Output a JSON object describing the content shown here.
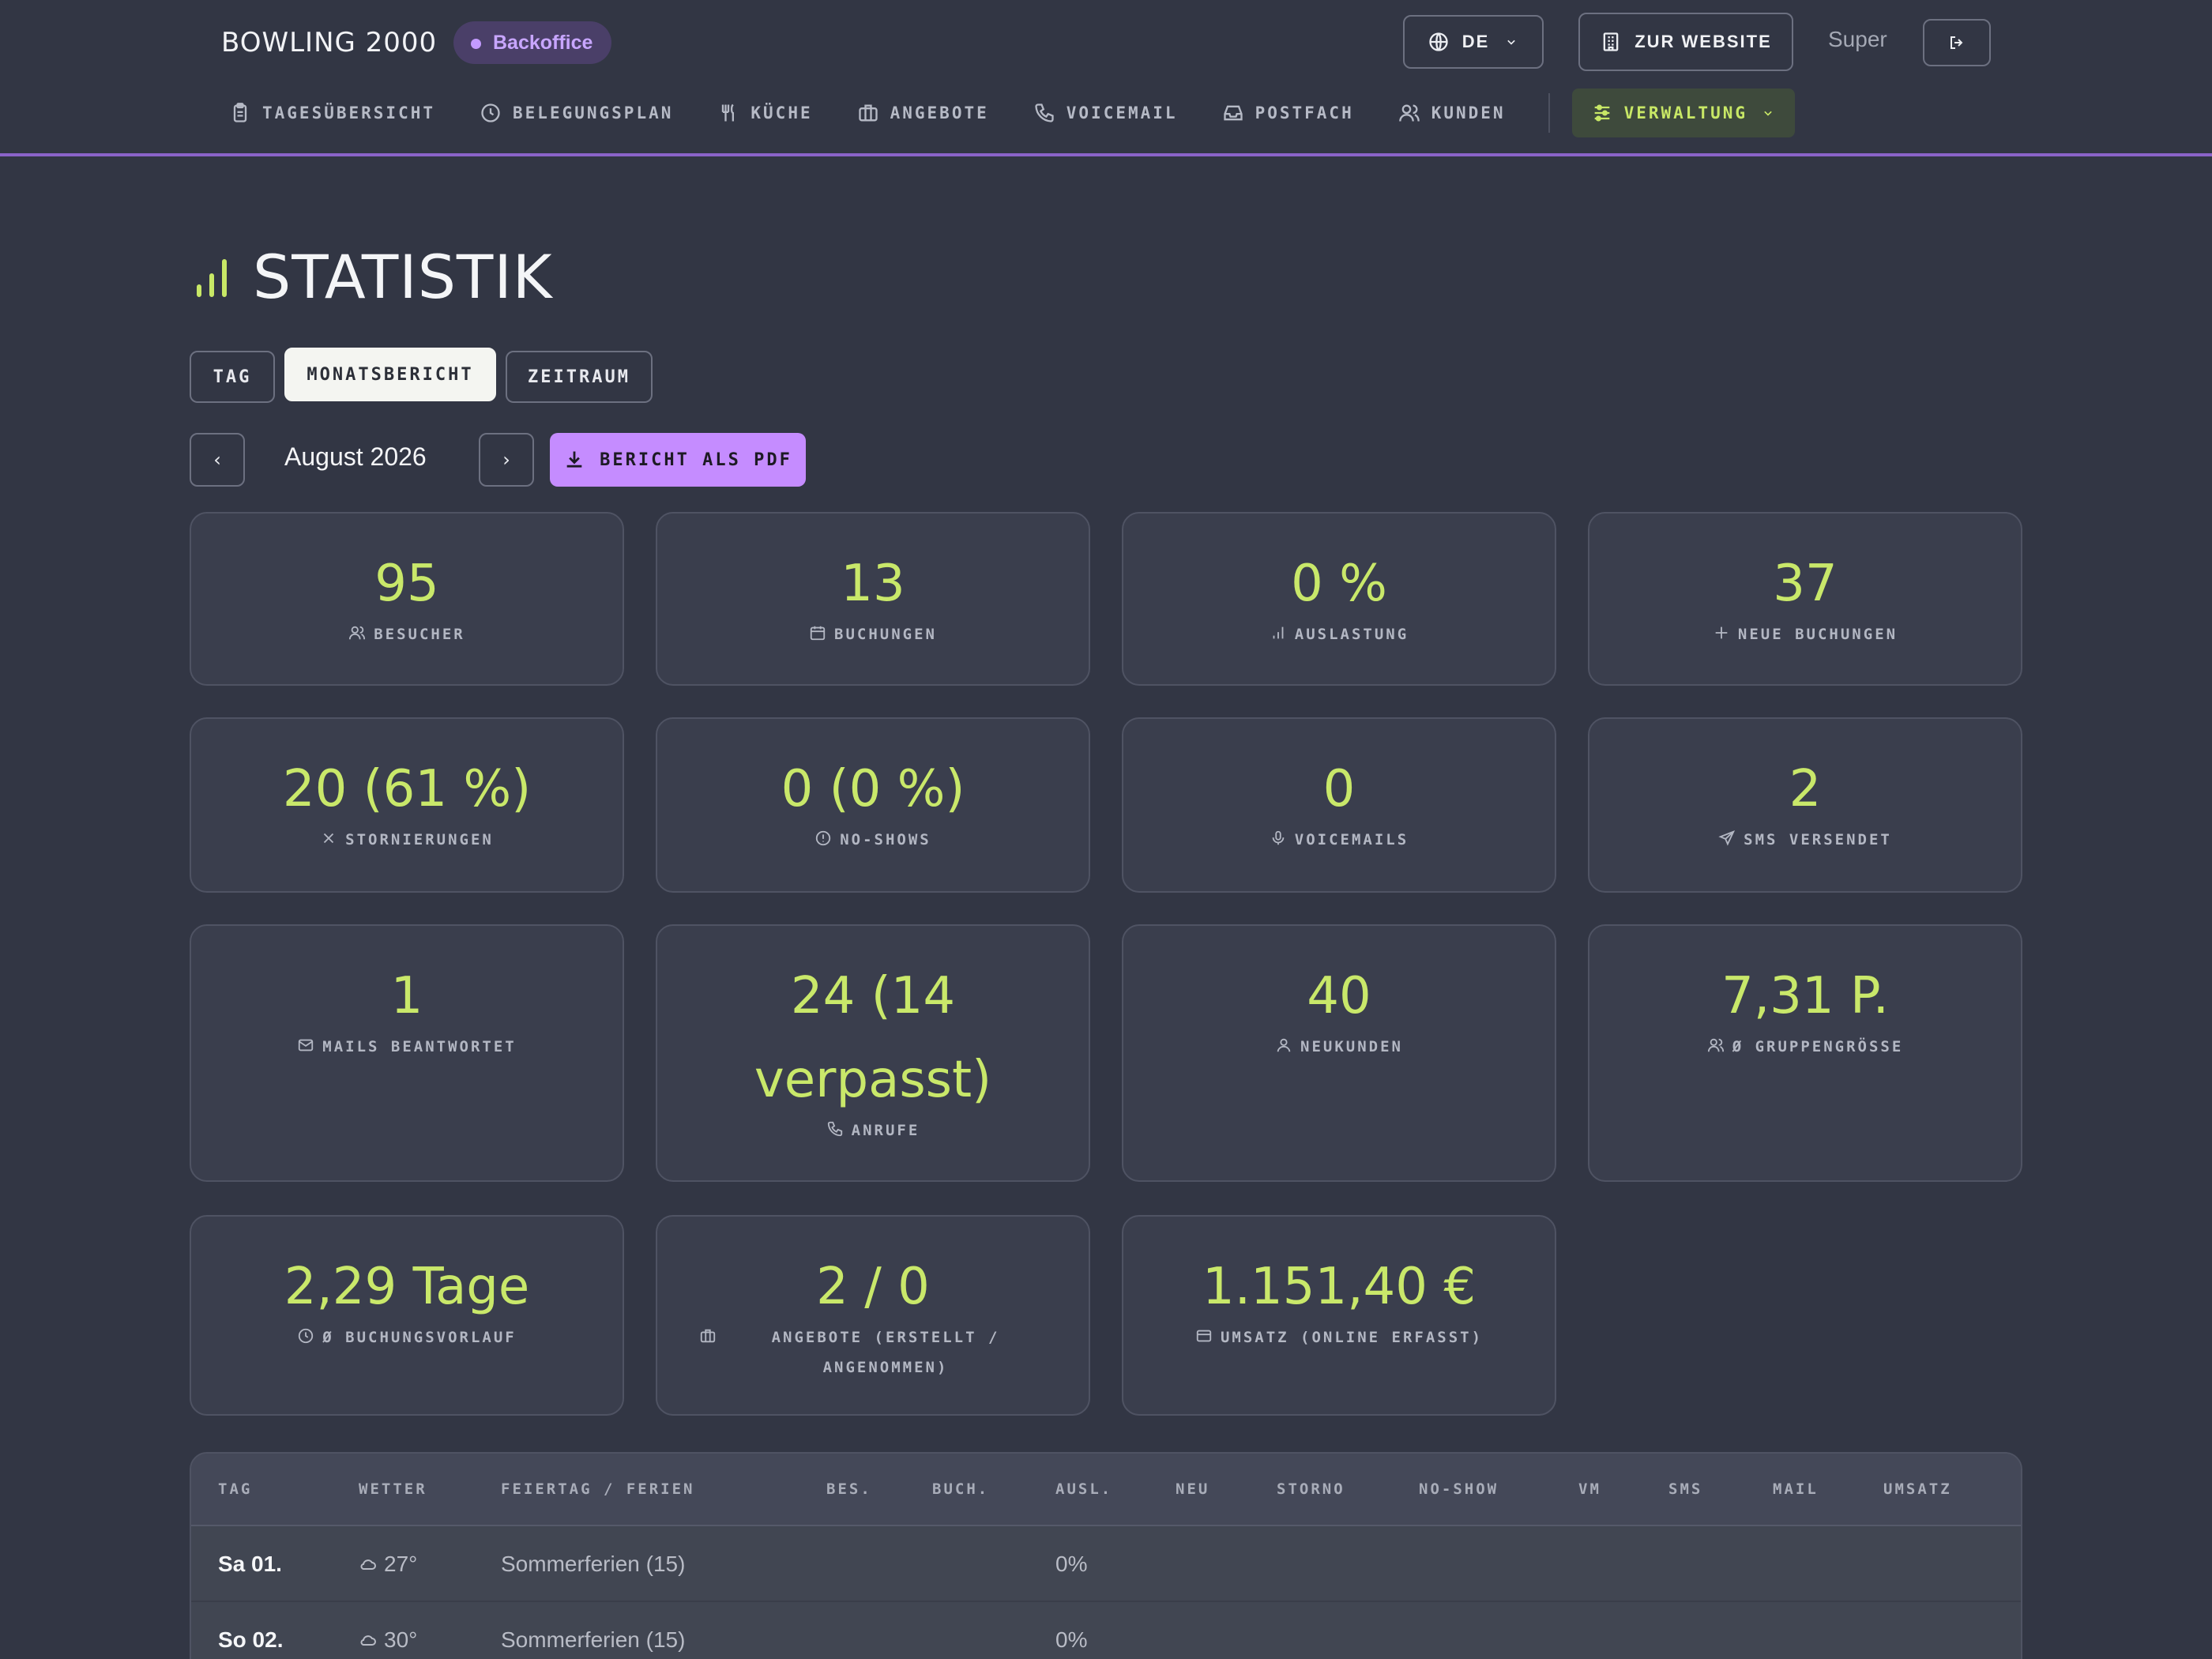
{
  "header": {
    "brand": "BOWLING 2000",
    "badge": "Backoffice",
    "language": "DE",
    "website_button": "ZUR WEBSITE",
    "user": "Super"
  },
  "nav": {
    "items": [
      {
        "label": "TAGESÜBERSICHT",
        "icon": "clipboard-icon"
      },
      {
        "label": "BELEGUNGSPLAN",
        "icon": "clock-icon"
      },
      {
        "label": "KÜCHE",
        "icon": "utensils-icon"
      },
      {
        "label": "ANGEBOTE",
        "icon": "briefcase-icon"
      },
      {
        "label": "VOICEMAIL",
        "icon": "phone-icon"
      },
      {
        "label": "POSTFACH",
        "icon": "inbox-icon"
      },
      {
        "label": "KUNDEN",
        "icon": "users-icon"
      }
    ],
    "admin": "VERWALTUNG"
  },
  "page": {
    "title": "STATISTIK",
    "tabs": [
      "TAG",
      "MONATSBERICHT",
      "ZEITRAUM"
    ],
    "active_tab": "MONATSBERICHT",
    "month": "August 2026",
    "prev": "‹",
    "next": "›",
    "pdf_button": "BERICHT ALS PDF"
  },
  "stats": [
    {
      "value": "95",
      "label": "BESUCHER",
      "icon": "users-icon"
    },
    {
      "value": "13",
      "label": "BUCHUNGEN",
      "icon": "calendar-icon"
    },
    {
      "value": "0 %",
      "label": "AUSLASTUNG",
      "icon": "bar-chart-icon"
    },
    {
      "value": "37",
      "label": "NEUE BUCHUNGEN",
      "icon": "plus-icon"
    },
    {
      "value": "20 (61 %)",
      "label": "STORNIERUNGEN",
      "icon": "x-icon"
    },
    {
      "value": "0 (0 %)",
      "label": "NO-SHOWS",
      "icon": "alert-icon"
    },
    {
      "value": "0",
      "label": "VOICEMAILS",
      "icon": "mic-icon"
    },
    {
      "value": "2",
      "label": "SMS VERSENDET",
      "icon": "send-icon"
    },
    {
      "value": "1",
      "label": "MAILS BEANTWORTET",
      "icon": "mail-icon"
    },
    {
      "value": "24 (14 verpasst)",
      "label": "ANRUFE",
      "icon": "phone-icon"
    },
    {
      "value": "40",
      "label": "NEUKUNDEN",
      "icon": "user-icon"
    },
    {
      "value": "7,31 P.",
      "label": "Ø GRUPPENGRÖSSE",
      "icon": "users-icon"
    },
    {
      "value": "2,29 Tage",
      "label": "Ø BUCHUNGSVORLAUF",
      "icon": "clock-icon"
    },
    {
      "value": "2 / 0",
      "label": "ANGEBOTE (ERSTELLT / ANGENOMMEN)",
      "icon": "briefcase-icon"
    },
    {
      "value": "1.151,40 €",
      "label": "UMSATZ (ONLINE ERFASST)",
      "icon": "credit-card-icon"
    }
  ],
  "table": {
    "columns": [
      "TAG",
      "WETTER",
      "FEIERTAG / FERIEN",
      "BES.",
      "BUCH.",
      "AUSL.",
      "NEU",
      "STORNO",
      "NO-SHOW",
      "VM",
      "SMS",
      "MAIL",
      "UMSATZ"
    ],
    "rows": [
      {
        "day": "Sa 01.",
        "weather": "27°",
        "holiday": "Sommerferien (15)",
        "util": "0%"
      },
      {
        "day": "So 02.",
        "weather": "30°",
        "holiday": "Sommerferien (15)",
        "util": "0%"
      }
    ]
  },
  "colors": {
    "background": "#323644",
    "accent_green": "#c9e86a",
    "accent_purple": "#c58cff"
  }
}
